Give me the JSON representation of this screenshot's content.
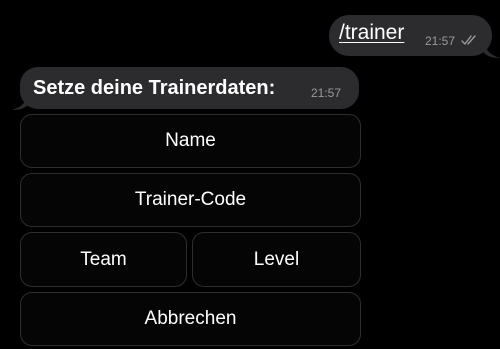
{
  "chat": {
    "outgoing": {
      "text": "/trainer",
      "time": "21:57",
      "status_icon": "double-check-read-icon"
    },
    "incoming": {
      "text": "Setze deine Trainerdaten:",
      "time": "21:57"
    },
    "keyboard": {
      "name_label": "Name",
      "code_label": "Trainer-Code",
      "team_label": "Team",
      "level_label": "Level",
      "cancel_label": "Abbrechen"
    }
  },
  "colors": {
    "background": "#000000",
    "bubble": "#2c2c2e",
    "button_border": "#2e2e31",
    "timestamp": "#9a9a9e",
    "text": "#ffffff"
  }
}
